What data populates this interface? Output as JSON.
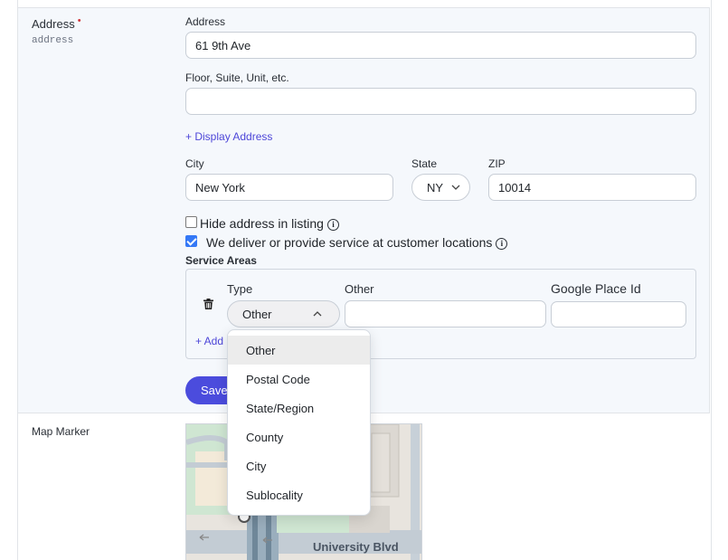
{
  "address_section": {
    "label": "Address",
    "required_mark": "•",
    "key": "address",
    "address_label": "Address",
    "address_value": "61 9th Ave",
    "floor_label": "Floor, Suite, Unit, etc.",
    "floor_value": "",
    "display_address_link": "+ Display Address",
    "city_label": "City",
    "city_value": "New York",
    "state_label": "State",
    "state_value": "NY",
    "zip_label": "ZIP",
    "zip_value": "10014",
    "hide_address_label": "Hide address in listing",
    "hide_address_checked": false,
    "deliver_label": "We deliver or provide service at customer locations",
    "deliver_checked": true
  },
  "service_areas": {
    "title": "Service Areas",
    "type_label": "Type",
    "type_value": "Other",
    "other_label": "Other",
    "other_value": "",
    "place_id_label": "Google Place Id",
    "place_id_value": "",
    "add_link": "+ Add",
    "type_options": [
      "Other",
      "Postal Code",
      "State/Region",
      "County",
      "City",
      "Sublocality"
    ],
    "selected_option": "Other"
  },
  "save_button": "Save",
  "map_section": {
    "label": "Map Marker",
    "street_label": "University Blvd"
  },
  "colors": {
    "accent": "#4b4cdd",
    "link": "#4d46d8",
    "required": "#d0353a",
    "section_bg": "#f5f8fc"
  }
}
